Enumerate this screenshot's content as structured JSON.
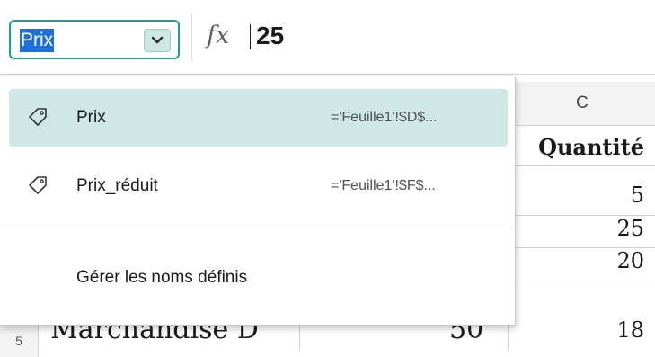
{
  "name_box": {
    "value": "Prix"
  },
  "formula_bar": {
    "fx_label": "fx",
    "value": "25"
  },
  "sheet": {
    "column_c_header": "C",
    "cells": [
      {
        "row": "header",
        "value": "Quantité"
      },
      {
        "row": "1",
        "value": "5"
      },
      {
        "row": "2",
        "value": "25"
      },
      {
        "row": "3",
        "value": "20"
      },
      {
        "row": "4",
        "value": "18"
      }
    ],
    "partial_row": {
      "row_number": "5",
      "label": "Marchandise D",
      "value": "50"
    }
  },
  "names_menu": {
    "items": [
      {
        "name": "Prix",
        "ref": "='Feuille1'!$D$...",
        "selected": true
      },
      {
        "name": "Prix_réduit",
        "ref": "='Feuille1'!$F$...",
        "selected": false
      }
    ],
    "manage_label": "Gérer les noms définis"
  },
  "colors": {
    "accent": "#1f9f86",
    "selection": "#cde8e6",
    "name_box_highlight": "#1e6fd6"
  }
}
